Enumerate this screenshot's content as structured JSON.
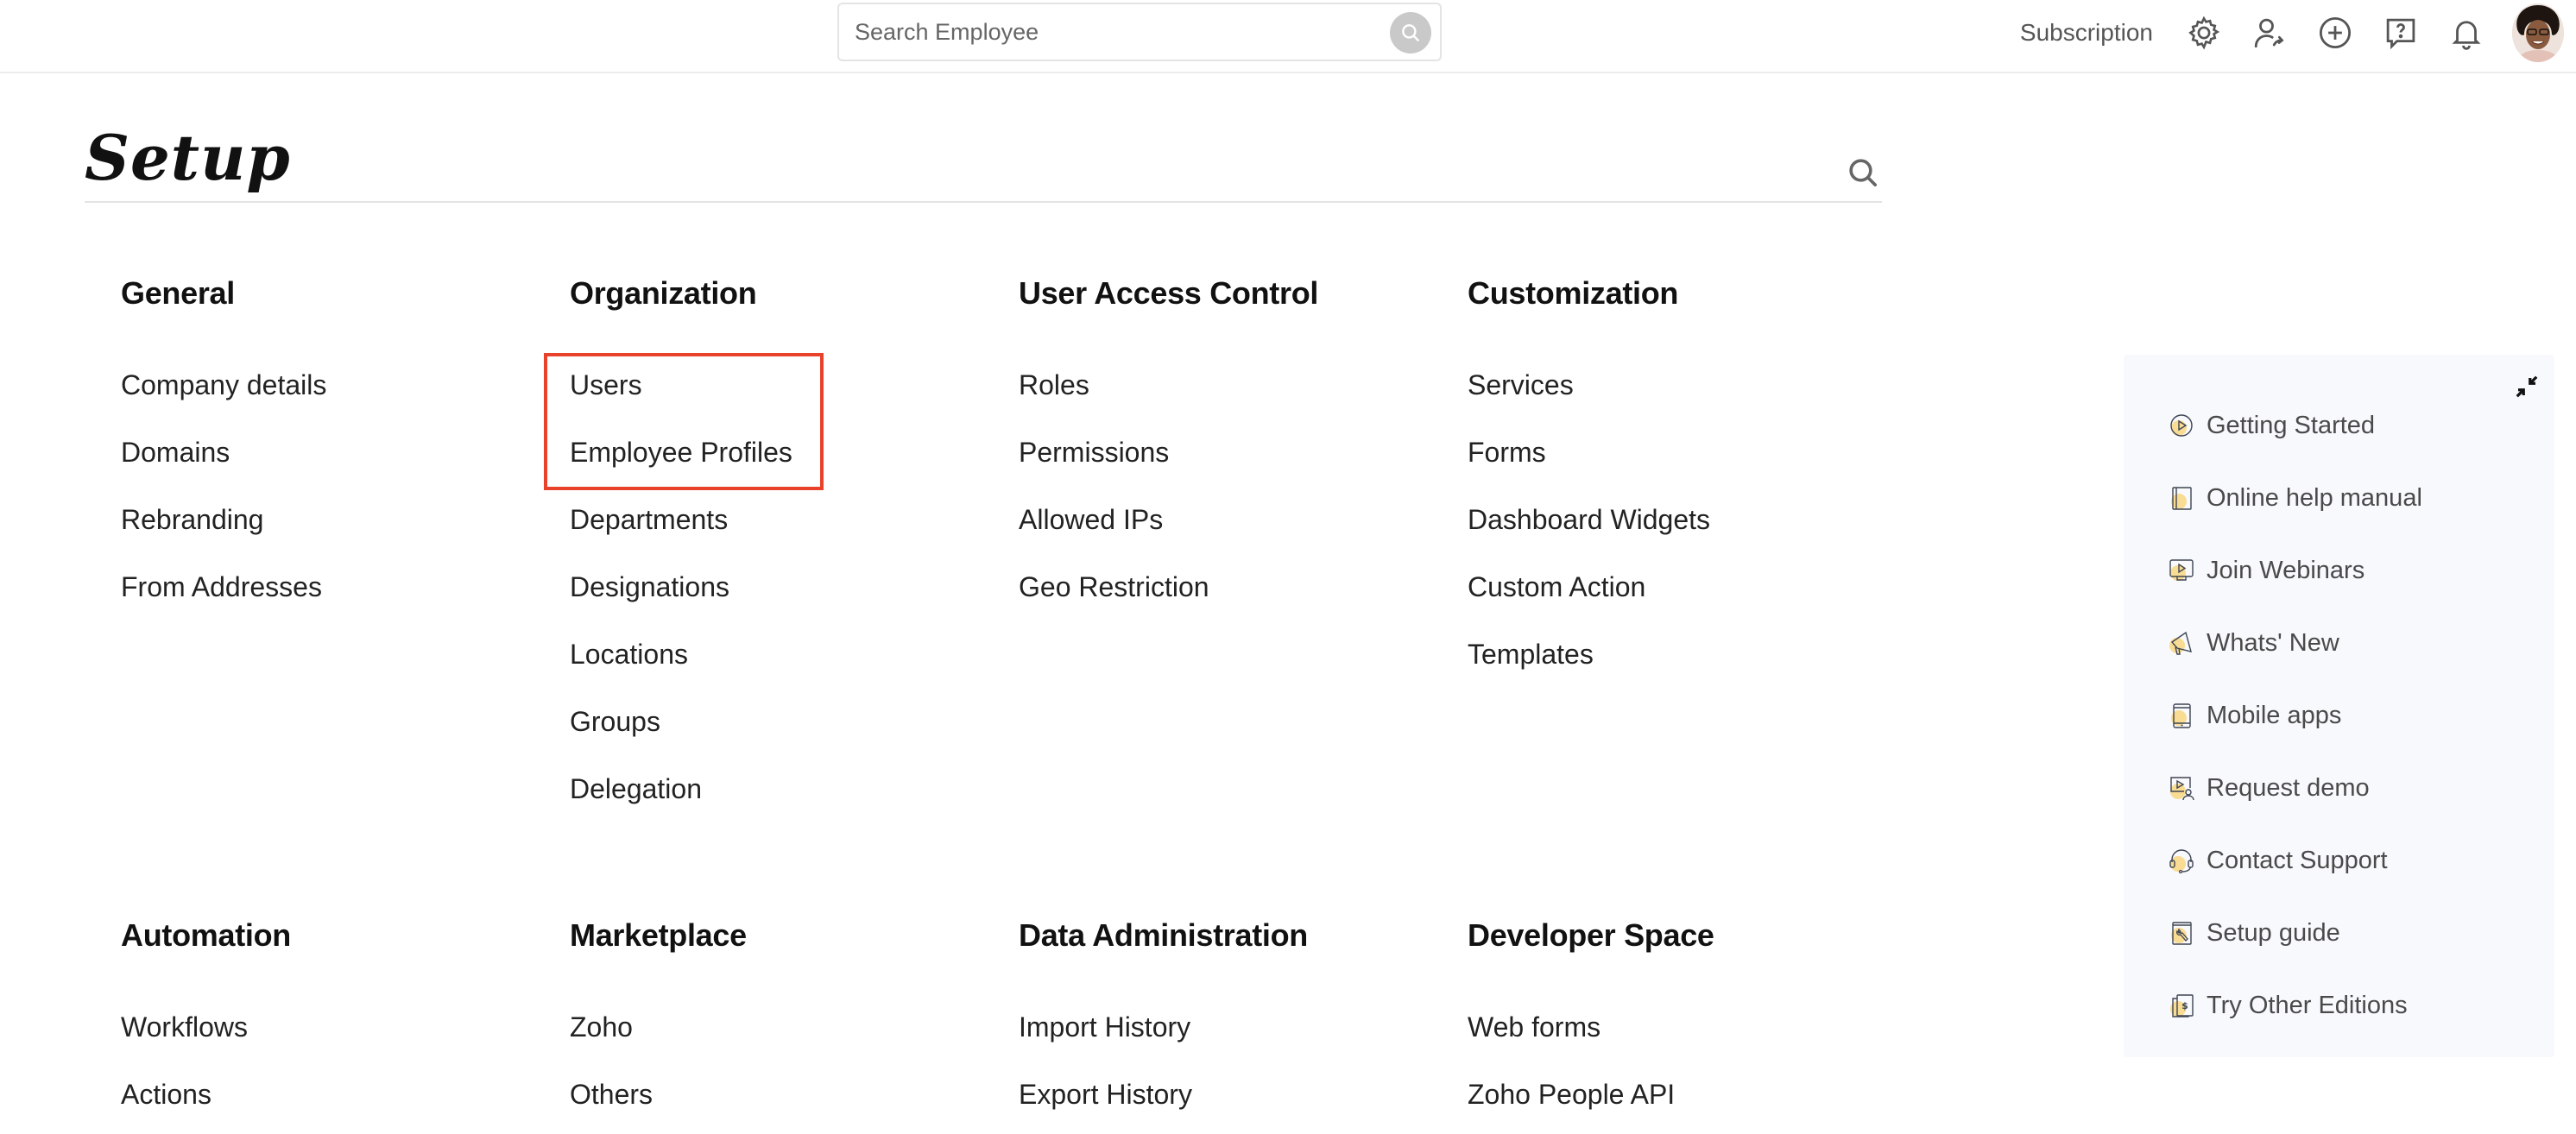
{
  "topbar": {
    "search_placeholder": "Search Employee",
    "subscription_label": "Subscription",
    "icons": [
      "settings-icon",
      "user-switch-icon",
      "add-icon",
      "help-icon",
      "notification-bell-icon"
    ]
  },
  "page": {
    "title": "Setup"
  },
  "sections": [
    {
      "title": "General",
      "items": [
        "Company details",
        "Domains",
        "Rebranding",
        "From Addresses"
      ]
    },
    {
      "title": "Organization",
      "items": [
        "Users",
        "Employee Profiles",
        "Departments",
        "Designations",
        "Locations",
        "Groups",
        "Delegation"
      ]
    },
    {
      "title": "User Access Control",
      "items": [
        "Roles",
        "Permissions",
        "Allowed IPs",
        "Geo Restriction"
      ]
    },
    {
      "title": "Customization",
      "items": [
        "Services",
        "Forms",
        "Dashboard Widgets",
        "Custom Action",
        "Templates"
      ]
    },
    {
      "title": "Automation",
      "items": [
        "Workflows",
        "Actions"
      ]
    },
    {
      "title": "Marketplace",
      "items": [
        "Zoho",
        "Others"
      ]
    },
    {
      "title": "Data Administration",
      "items": [
        "Import History",
        "Export History"
      ]
    },
    {
      "title": "Developer Space",
      "items": [
        "Web forms",
        "Zoho People API"
      ]
    }
  ],
  "highlight": {
    "section": "Organization",
    "items": [
      "Users",
      "Employee Profiles"
    ],
    "color": "#e8432a"
  },
  "help_panel": {
    "items": [
      {
        "label": "Getting Started",
        "icon": "play-circle-icon"
      },
      {
        "label": "Online help manual",
        "icon": "book-icon"
      },
      {
        "label": "Join Webinars",
        "icon": "monitor-play-icon"
      },
      {
        "label": "Whats' New",
        "icon": "megaphone-icon"
      },
      {
        "label": "Mobile apps",
        "icon": "mobile-icon"
      },
      {
        "label": "Request demo",
        "icon": "demo-presenter-icon"
      },
      {
        "label": "Contact Support",
        "icon": "headset-icon"
      },
      {
        "label": "Setup guide",
        "icon": "setup-guide-icon"
      },
      {
        "label": "Try Other Editions",
        "icon": "editions-icon"
      }
    ]
  },
  "colors": {
    "accent_icon_fill": "#f9dc94",
    "panel_bg": "#f8f9fd",
    "highlight": "#e8432a"
  }
}
